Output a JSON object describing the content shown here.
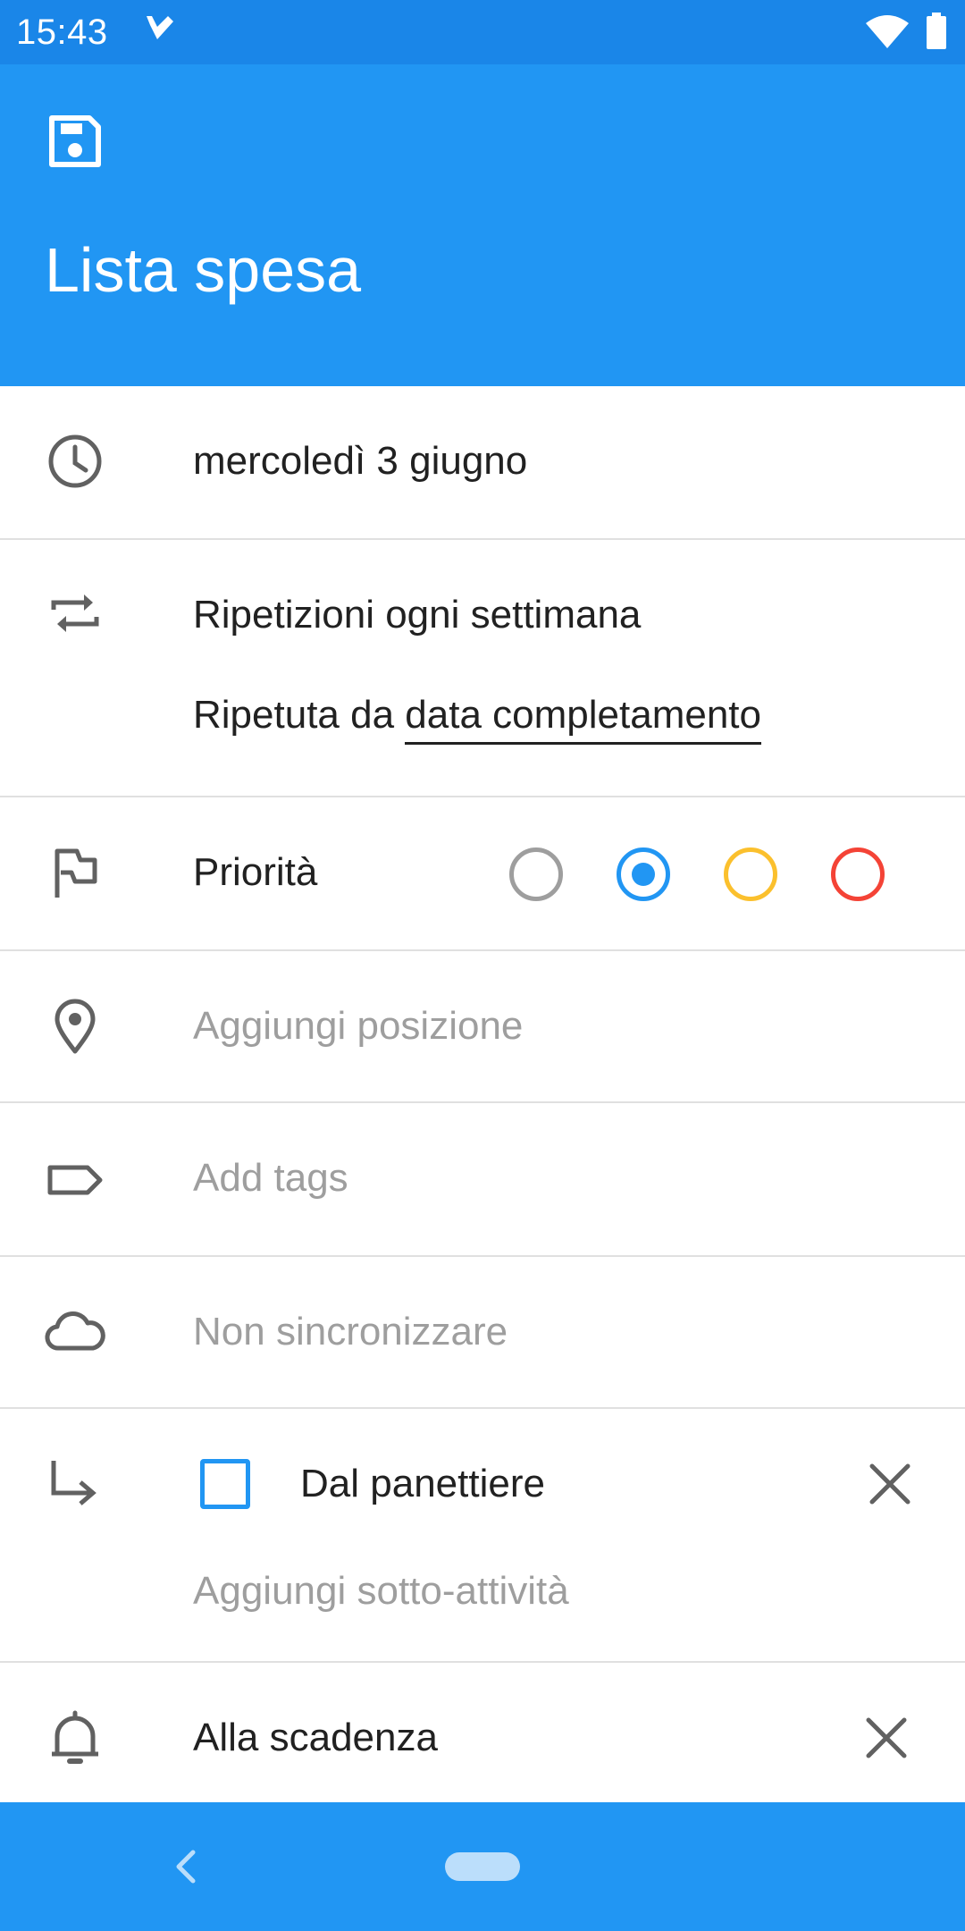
{
  "status_bar": {
    "time": "15:43",
    "app_icon": "tasks-check-icon",
    "wifi_icon": "wifi-icon",
    "battery_icon": "battery-icon"
  },
  "app_bar": {
    "save_icon": "save-icon",
    "title": "Lista spesa"
  },
  "due_date": {
    "icon": "clock-icon",
    "label": "mercoledì 3 giugno"
  },
  "repeat": {
    "icon": "repeat-icon",
    "label": "Ripetizioni ogni settimana",
    "from_prefix": "Ripetuta da",
    "from_value": "data completamento"
  },
  "priority": {
    "icon": "flag-icon",
    "label": "Priorità",
    "options": [
      {
        "name": "none",
        "color": "#9e9e9e",
        "selected": false
      },
      {
        "name": "low",
        "color": "#2196f3",
        "selected": true
      },
      {
        "name": "medium",
        "color": "#fbc02d",
        "selected": false
      },
      {
        "name": "high",
        "color": "#f44336",
        "selected": false
      }
    ]
  },
  "location": {
    "icon": "location-pin-icon",
    "placeholder": "Aggiungi posizione"
  },
  "tags": {
    "icon": "tag-icon",
    "placeholder": "Add tags"
  },
  "sync": {
    "icon": "cloud-icon",
    "label": "Non sincronizzare"
  },
  "subtasks": {
    "icon": "subtask-arrow-icon",
    "items": [
      {
        "label": "Dal panettiere",
        "checked": false
      }
    ],
    "add_label": "Aggiungi sotto-attività"
  },
  "reminder": {
    "icon": "bell-icon",
    "label": "Alla scadenza"
  },
  "nav_bar": {
    "back_icon": "back-icon",
    "home_icon": "home-pill-icon"
  },
  "colors": {
    "status_bar": "#1a86e8",
    "primary": "#2196f3",
    "text": "#212121",
    "hint": "#9e9e9e",
    "icon": "#616161"
  }
}
